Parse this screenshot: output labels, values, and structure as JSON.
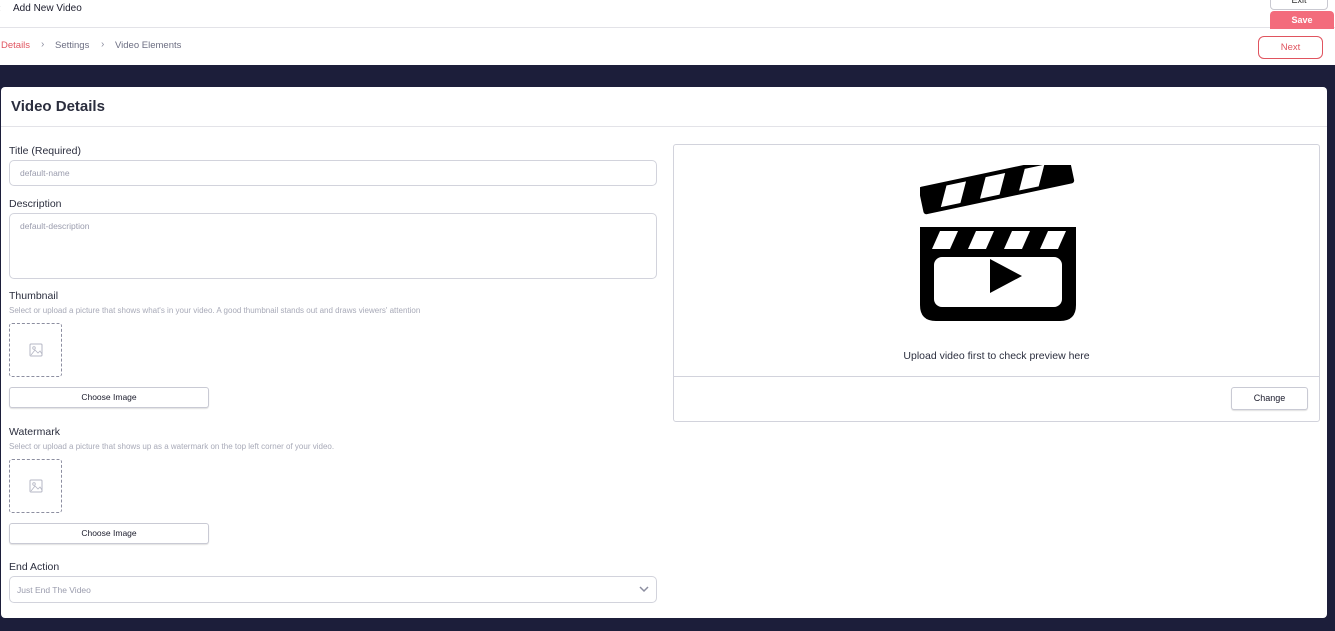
{
  "header": {
    "back_glyph": "‹",
    "title": "Add New Video",
    "exit_label": "Exit",
    "save_label": "Save"
  },
  "breadcrumb": {
    "items": [
      "Details",
      "Settings",
      "Video Elements"
    ],
    "next_label": "Next"
  },
  "card": {
    "title": "Video Details"
  },
  "form": {
    "title_label": "Title (Required)",
    "title_placeholder": "default-name",
    "description_label": "Description",
    "description_placeholder": "default-description",
    "thumbnail_label": "Thumbnail",
    "thumbnail_hint": "Select or upload a picture that shows what's in your video. A good thumbnail stands out and draws viewers' attention",
    "thumbnail_button": "Choose Image",
    "watermark_label": "Watermark",
    "watermark_hint": "Select or upload a picture that shows up as a watermark on the top left corner of your video.",
    "watermark_button": "Choose Image",
    "end_action_label": "End Action",
    "end_action_value": "Just End The Video"
  },
  "preview": {
    "icon": "clapperboard-icon",
    "message": "Upload video first to check preview here",
    "change_label": "Change"
  },
  "colors": {
    "accent": "#e0545f",
    "save": "#f36c7c",
    "background_dark": "#1c1e3a"
  }
}
